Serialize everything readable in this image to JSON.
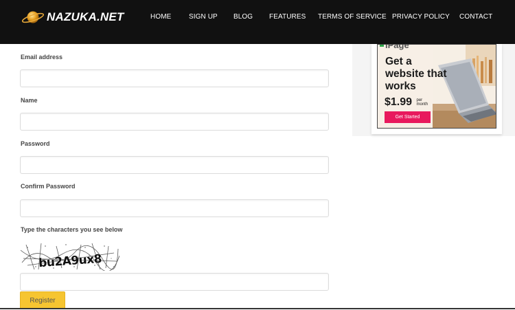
{
  "header": {
    "logo_text": "NAZUKA.NET",
    "logo_icon": "planet-icon",
    "nav": [
      "HOME",
      "SIGN UP",
      "BLOG",
      "FEATURES",
      "TERMS OF SERVICE",
      "PRIVACY POLICY",
      "CONTACT"
    ]
  },
  "form": {
    "email_label": "Email address",
    "email_value": "",
    "name_label": "Name",
    "name_value": "",
    "password_label": "Password",
    "password_value": "",
    "confirm_password_label": "Confirm Password",
    "confirm_password_value": "",
    "captcha_label": "Type the characters you see below",
    "captcha_text": "bu2A9ux8",
    "captcha_value": "",
    "register_label": "Register"
  },
  "ad": {
    "brand": "iPage",
    "headline": "Get a website that works",
    "price": "$1.99",
    "price_unit": "per month",
    "cta": "Get Started",
    "cta_color": "#e8195d"
  },
  "colors": {
    "header_bg": "#111111",
    "button_bg": "#f6c531"
  }
}
